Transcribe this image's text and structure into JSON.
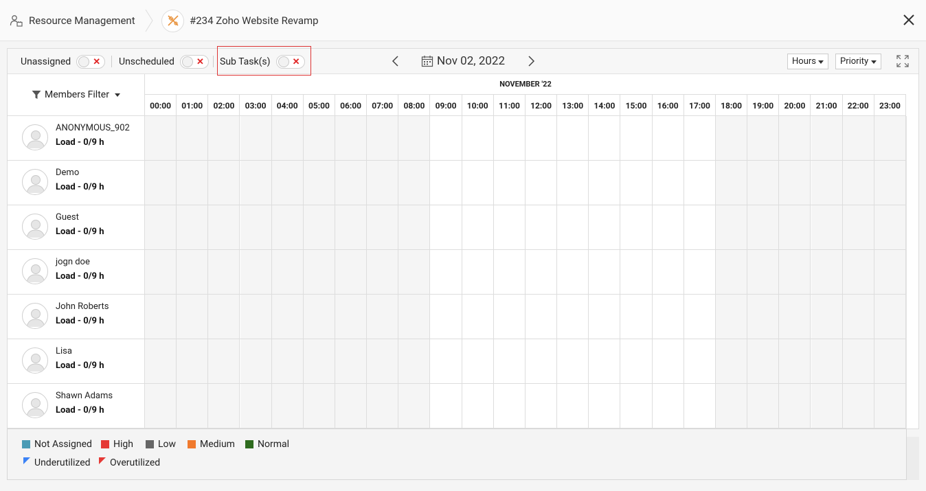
{
  "header": {
    "module_title": "Resource Management",
    "project_title": "#234 Zoho Website Revamp"
  },
  "toolbar": {
    "unassigned_label": "Unassigned",
    "unscheduled_label": "Unscheduled",
    "subtasks_label": "Sub Task(s)",
    "date": "Nov 02, 2022",
    "view_select": "Hours",
    "sort_select": "Priority"
  },
  "members_filter_label": "Members Filter",
  "timeline": {
    "month": "NOVEMBER '22",
    "hours": [
      "00:00",
      "01:00",
      "02:00",
      "03:00",
      "04:00",
      "05:00",
      "06:00",
      "07:00",
      "08:00",
      "09:00",
      "10:00",
      "11:00",
      "12:00",
      "13:00",
      "14:00",
      "15:00",
      "16:00",
      "17:00",
      "18:00",
      "19:00",
      "20:00",
      "21:00",
      "22:00",
      "23:00"
    ]
  },
  "members": [
    {
      "name": "ANONYMOUS_902",
      "load": "Load - 0/9 h"
    },
    {
      "name": "Demo",
      "load": "Load - 0/9 h"
    },
    {
      "name": "Guest",
      "load": "Load - 0/9 h"
    },
    {
      "name": "jogn doe",
      "load": "Load - 0/9 h"
    },
    {
      "name": "John Roberts",
      "load": "Load - 0/9 h"
    },
    {
      "name": "Lisa",
      "load": "Load - 0/9 h"
    },
    {
      "name": "Shawn Adams",
      "load": "Load - 0/9 h"
    }
  ],
  "legend": {
    "not_assigned": {
      "label": "Not Assigned",
      "color": "#4a9bb5"
    },
    "high": {
      "label": "High",
      "color": "#e53935"
    },
    "low": {
      "label": "Low",
      "color": "#666666"
    },
    "medium": {
      "label": "Medium",
      "color": "#f07a2e"
    },
    "normal": {
      "label": "Normal",
      "color": "#2e6b1e"
    },
    "underutilized": {
      "label": "Underutilized",
      "color": "#3b82f6"
    },
    "overutilized": {
      "label": "Overutilized",
      "color": "#e53935"
    }
  }
}
